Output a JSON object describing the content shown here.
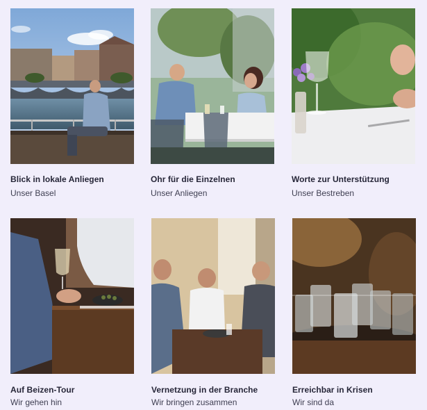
{
  "cards": [
    {
      "title": "Blick in lokale Anliegen",
      "subtitle": "Unser Basel"
    },
    {
      "title": "Ohr für die Einzelnen",
      "subtitle": "Unser Anliegen"
    },
    {
      "title": "Worte zur Unterstützung",
      "subtitle": "Unser Bestreben"
    },
    {
      "title": "Auf Beizen-Tour",
      "subtitle": "Wir gehen hin"
    },
    {
      "title": "Vernetzung in der Branche",
      "subtitle": "Wir bringen zusammen"
    },
    {
      "title": "Erreichbar in Krisen",
      "subtitle": "Wir sind da"
    }
  ],
  "colors": {
    "background": "#f1eefb",
    "title_text": "#262638",
    "subtitle_text": "#3f3f52"
  }
}
